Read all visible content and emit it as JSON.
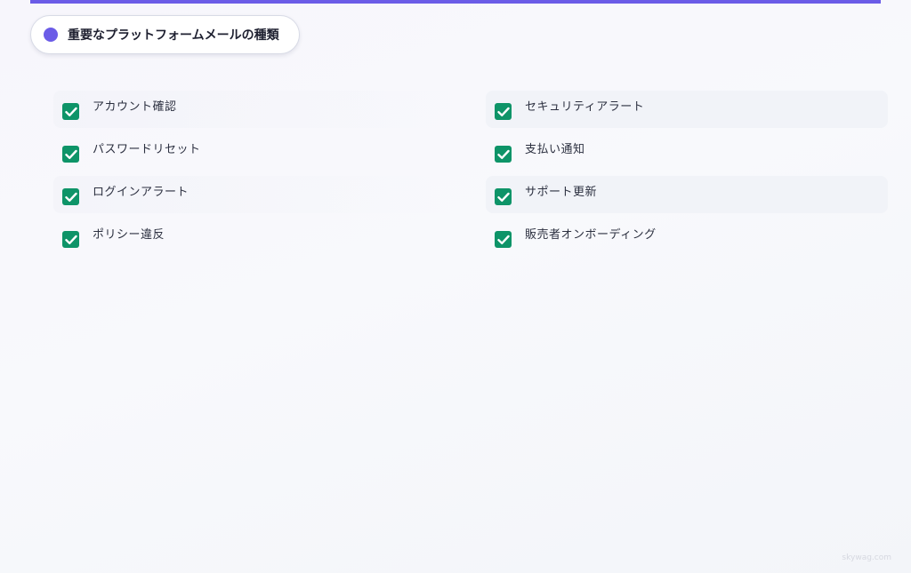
{
  "header": {
    "title": "重要なプラットフォームメールの種類",
    "accent_color": "#6b5ce7"
  },
  "checklist": {
    "check_color": "#0e9468",
    "items": [
      {
        "label": "アカウント確認",
        "checked": true
      },
      {
        "label": "セキュリティアラート",
        "checked": true
      },
      {
        "label": "パスワードリセット",
        "checked": true
      },
      {
        "label": "支払い通知",
        "checked": true
      },
      {
        "label": "ログインアラート",
        "checked": true
      },
      {
        "label": "サポート更新",
        "checked": true
      },
      {
        "label": "ポリシー違反",
        "checked": true
      },
      {
        "label": "販売者オンボーディング",
        "checked": true
      }
    ]
  },
  "footer": {
    "watermark": "skywag.com"
  }
}
